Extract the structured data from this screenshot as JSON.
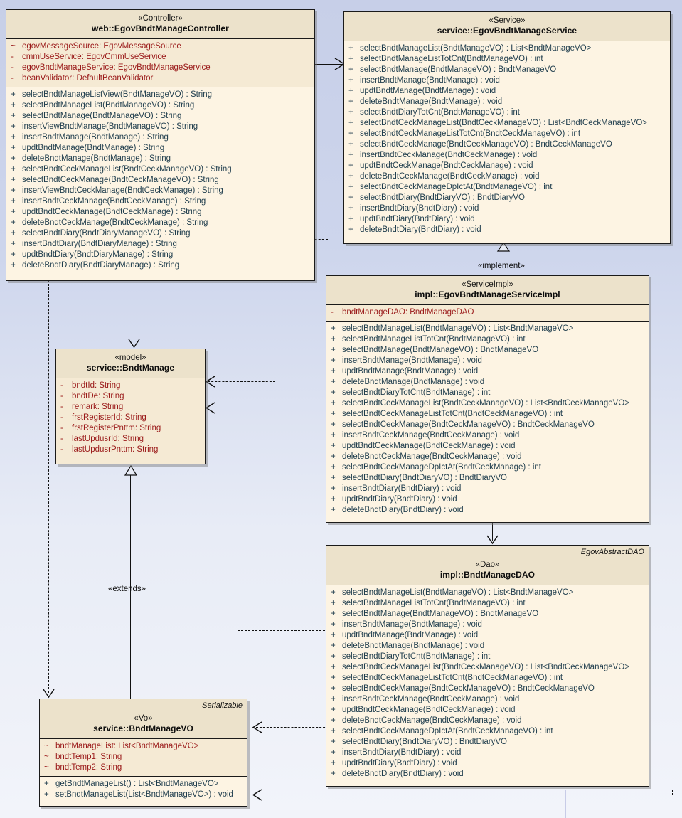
{
  "diagram": {
    "title": "EgovBndtManage UML class diagram",
    "colors": {
      "class_fill": "#fdf4e3",
      "header_fill": "#ece2cb",
      "attr_fill": "#f5ead4",
      "border": "#1a1a1a",
      "attr_text": "#9a1919",
      "op_text": "#1f3d4d",
      "canvas_top": "#c7cfe8",
      "canvas_bottom": "#f2f4fa"
    }
  },
  "classes": {
    "controller": {
      "stereotype": "«Controller»",
      "name": "web::EgovBndtManageController",
      "attributes": [
        {
          "vis": "~",
          "text": "egovMessageSource:  EgovMessageSource"
        },
        {
          "vis": "-",
          "text": "cmmUseService:  EgovCmmUseService"
        },
        {
          "vis": "-",
          "text": "egovBndtManageService:  EgovBndtManageService"
        },
        {
          "vis": "-",
          "text": "beanValidator:  DefaultBeanValidator"
        }
      ],
      "operations": [
        {
          "vis": "+",
          "text": "selectBndtManageListView(BndtManageVO) : String"
        },
        {
          "vis": "+",
          "text": "selectBndtManageList(BndtManageVO) : String"
        },
        {
          "vis": "+",
          "text": "selectBndtManage(BndtManageVO) : String"
        },
        {
          "vis": "+",
          "text": "insertViewBndtManage(BndtManageVO) : String"
        },
        {
          "vis": "+",
          "text": "insertBndtManage(BndtManage) : String"
        },
        {
          "vis": "+",
          "text": "updtBndtManage(BndtManage) : String"
        },
        {
          "vis": "+",
          "text": "deleteBndtManage(BndtManage) : String"
        },
        {
          "vis": "+",
          "text": "selectBndtCeckManageList(BndtCeckManageVO) : String"
        },
        {
          "vis": "+",
          "text": "selectBndtCeckManage(BndtCeckManageVO) : String"
        },
        {
          "vis": "+",
          "text": "insertViewBndtCeckManage(BndtCeckManage) : String"
        },
        {
          "vis": "+",
          "text": "insertBndtCeckManage(BndtCeckManage) : String"
        },
        {
          "vis": "+",
          "text": "updtBndtCeckManage(BndtCeckManage) : String"
        },
        {
          "vis": "+",
          "text": "deleteBndtCeckManage(BndtCeckManage) : String"
        },
        {
          "vis": "+",
          "text": "selectBndtDiary(BndtDiaryManageVO) : String"
        },
        {
          "vis": "+",
          "text": "insertBndtDiary(BndtDiaryManage) : String"
        },
        {
          "vis": "+",
          "text": "updtBndtDiary(BndtDiaryManage) : String"
        },
        {
          "vis": "+",
          "text": "deleteBndtDiary(BndtDiaryManage) : String"
        }
      ]
    },
    "service": {
      "stereotype": "«Service»",
      "name": "service::EgovBndtManageService",
      "operations": [
        {
          "vis": "+",
          "text": "selectBndtManageList(BndtManageVO) : List<BndtManageVO>"
        },
        {
          "vis": "+",
          "text": "selectBndtManageListTotCnt(BndtManageVO) : int"
        },
        {
          "vis": "+",
          "text": "selectBndtManage(BndtManageVO) : BndtManageVO"
        },
        {
          "vis": "+",
          "text": "insertBndtManage(BndtManage) : void"
        },
        {
          "vis": "+",
          "text": "updtBndtManage(BndtManage) : void"
        },
        {
          "vis": "+",
          "text": "deleteBndtManage(BndtManage) : void"
        },
        {
          "vis": "+",
          "text": "selectBndtDiaryTotCnt(BndtManageVO) : int"
        },
        {
          "vis": "+",
          "text": "selectBndtCeckManageList(BndtCeckManageVO) : List<BndtCeckManageVO>"
        },
        {
          "vis": "+",
          "text": "selectBndtCeckManageListTotCnt(BndtCeckManageVO) : int"
        },
        {
          "vis": "+",
          "text": "selectBndtCeckManage(BndtCeckManageVO) : BndtCeckManageVO"
        },
        {
          "vis": "+",
          "text": "insertBndtCeckManage(BndtCeckManage) : void"
        },
        {
          "vis": "+",
          "text": "updtBndtCeckManage(BndtCeckManage) : void"
        },
        {
          "vis": "+",
          "text": "deleteBndtCeckManage(BndtCeckManage) : void"
        },
        {
          "vis": "+",
          "text": "selectBndtCeckManageDpIctAt(BndtManageVO) : int"
        },
        {
          "vis": "+",
          "text": "selectBndtDiary(BndtDiaryVO) : BndtDiaryVO"
        },
        {
          "vis": "+",
          "text": "insertBndtDiary(BndtDiary) : void"
        },
        {
          "vis": "+",
          "text": "updtBndtDiary(BndtDiary) : void"
        },
        {
          "vis": "+",
          "text": "deleteBndtDiary(BndtDiary) : void"
        }
      ]
    },
    "service_impl": {
      "stereotype": "«ServiceImpl»",
      "name": "impl::EgovBndtManageServiceImpl",
      "attributes": [
        {
          "vis": "-",
          "text": "bndtManageDAO:  BndtManageDAO"
        }
      ],
      "operations": [
        {
          "vis": "+",
          "text": "selectBndtManageList(BndtManageVO) : List<BndtManageVO>"
        },
        {
          "vis": "+",
          "text": "selectBndtManageListTotCnt(BndtManageVO) : int"
        },
        {
          "vis": "+",
          "text": "selectBndtManage(BndtManageVO) : BndtManageVO"
        },
        {
          "vis": "+",
          "text": "insertBndtManage(BndtManage) : void"
        },
        {
          "vis": "+",
          "text": "updtBndtManage(BndtManage) : void"
        },
        {
          "vis": "+",
          "text": "deleteBndtManage(BndtManage) : void"
        },
        {
          "vis": "+",
          "text": "selectBndtDiaryTotCnt(BndtManage) : int"
        },
        {
          "vis": "+",
          "text": "selectBndtCeckManageList(BndtCeckManageVO) : List<BndtCeckManageVO>"
        },
        {
          "vis": "+",
          "text": "selectBndtCeckManageListTotCnt(BndtCeckManageVO) : int"
        },
        {
          "vis": "+",
          "text": "selectBndtCeckManage(BndtCeckManageVO) : BndtCeckManageVO"
        },
        {
          "vis": "+",
          "text": "insertBndtCeckManage(BndtCeckManage) : void"
        },
        {
          "vis": "+",
          "text": "updtBndtCeckManage(BndtCeckManage) : void"
        },
        {
          "vis": "+",
          "text": "deleteBndtCeckManage(BndtCeckManage) : void"
        },
        {
          "vis": "+",
          "text": "selectBndtCeckManageDpIctAt(BndtCeckManage) : int"
        },
        {
          "vis": "+",
          "text": "selectBndtDiary(BndtDiaryVO) : BndtDiaryVO"
        },
        {
          "vis": "+",
          "text": "insertBndtDiary(BndtDiary) : void"
        },
        {
          "vis": "+",
          "text": "updtBndtDiary(BndtDiary) : void"
        },
        {
          "vis": "+",
          "text": "deleteBndtDiary(BndtDiary) : void"
        }
      ]
    },
    "dao": {
      "corner_note": "EgovAbstractDAO",
      "stereotype": "«Dao»",
      "name": "impl::BndtManageDAO",
      "operations": [
        {
          "vis": "+",
          "text": "selectBndtManageList(BndtManageVO) : List<BndtManageVO>"
        },
        {
          "vis": "+",
          "text": "selectBndtManageListTotCnt(BndtManageVO) : int"
        },
        {
          "vis": "+",
          "text": "selectBndtManage(BndtManageVO) : BndtManageVO"
        },
        {
          "vis": "+",
          "text": "insertBndtManage(BndtManage) : void"
        },
        {
          "vis": "+",
          "text": "updtBndtManage(BndtManage) : void"
        },
        {
          "vis": "+",
          "text": "deleteBndtManage(BndtManage) : void"
        },
        {
          "vis": "+",
          "text": "selectBndtDiaryTotCnt(BndtManage) : int"
        },
        {
          "vis": "+",
          "text": "selectBndtCeckManageList(BndtCeckManageVO) : List<BndtCeckManageVO>"
        },
        {
          "vis": "+",
          "text": "selectBndtCeckManageListTotCnt(BndtCeckManageVO) : int"
        },
        {
          "vis": "+",
          "text": "selectBndtCeckManage(BndtCeckManageVO) : BndtCeckManageVO"
        },
        {
          "vis": "+",
          "text": "insertBndtCeckManage(BndtCeckManage) : void"
        },
        {
          "vis": "+",
          "text": "updtBndtCeckManage(BndtCeckManage) : void"
        },
        {
          "vis": "+",
          "text": "deleteBndtCeckManage(BndtCeckManage) : void"
        },
        {
          "vis": "+",
          "text": "selectBndtCeckManageDpIctAt(BndtCeckManageVO) : int"
        },
        {
          "vis": "+",
          "text": "selectBndtDiary(BndtDiaryVO) : BndtDiaryVO"
        },
        {
          "vis": "+",
          "text": "insertBndtDiary(BndtDiary) : void"
        },
        {
          "vis": "+",
          "text": "updtBndtDiary(BndtDiary) : void"
        },
        {
          "vis": "+",
          "text": "deleteBndtDiary(BndtDiary) : void"
        }
      ]
    },
    "model": {
      "stereotype": "«model»",
      "name": "service::BndtManage",
      "attributes": [
        {
          "vis": "-",
          "text": "bndtId:  String"
        },
        {
          "vis": "-",
          "text": "bndtDe:  String"
        },
        {
          "vis": "-",
          "text": "remark:  String"
        },
        {
          "vis": "-",
          "text": "frstRegisterId:  String"
        },
        {
          "vis": "-",
          "text": "frstRegisterPnttm:  String"
        },
        {
          "vis": "-",
          "text": "lastUpdusrId:  String"
        },
        {
          "vis": "-",
          "text": "lastUpdusrPnttm:  String"
        }
      ]
    },
    "vo": {
      "corner_note": "Serializable",
      "stereotype": "«Vo»",
      "name": "service::BndtManageVO",
      "attributes": [
        {
          "vis": "~",
          "text": "bndtManageList:  List<BndtManageVO>"
        },
        {
          "vis": "~",
          "text": "bndtTemp1:  String"
        },
        {
          "vis": "~",
          "text": "bndtTemp2:  String"
        }
      ],
      "operations": [
        {
          "vis": "+",
          "text": "getBndtManageList() : List<BndtManageVO>"
        },
        {
          "vis": "+",
          "text": "setBndtManageList(List<BndtManageVO>) : void"
        }
      ]
    }
  },
  "connectors": {
    "implement_label": "«implement»",
    "extends_label": "«extends»"
  }
}
